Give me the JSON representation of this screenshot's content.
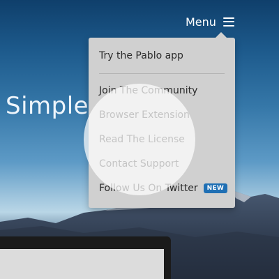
{
  "header": {
    "menu_label": "Menu"
  },
  "hero": {
    "heading": "Simple"
  },
  "dropdown": {
    "items": [
      {
        "label": "Try the Pablo app"
      },
      {
        "label": "Join The Community"
      },
      {
        "label": "Browser Extension"
      },
      {
        "label": "Read The License"
      },
      {
        "label": "Contact Support"
      },
      {
        "label": "Follow Us On Twitter",
        "badge": "NEW"
      }
    ]
  },
  "icons": {
    "menu": "hamburger-icon"
  },
  "colors": {
    "sky_top": "#0f3f6b",
    "dropdown_bg": "#d0d0d0",
    "menu_text": "#2b2b2b",
    "badge_bg": "#1f6fb4"
  }
}
